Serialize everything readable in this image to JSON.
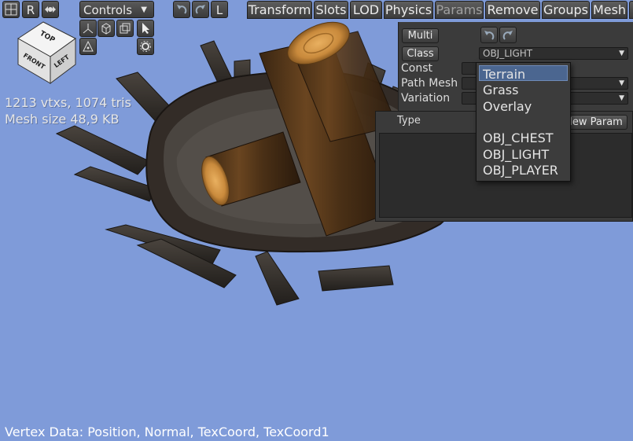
{
  "toolbar": {
    "r_label": "R",
    "controls_label": "Controls",
    "controls_arrow": "▼",
    "l_label": "L"
  },
  "tabs": [
    "Transform",
    "Slots",
    "LOD",
    "Physics",
    "Params",
    "Remove",
    "Groups",
    "Mesh"
  ],
  "disabled_tab": "Params",
  "params": {
    "multi_label": "Multi",
    "class_label": "Class",
    "class_value": "OBJ_LIGHT",
    "const_label": "Const",
    "path_mesh_label": "Path Mesh",
    "variation_label": "Variation",
    "type_header": "Type",
    "new_param_label": "New Param"
  },
  "dropdown": {
    "options": [
      "Terrain",
      "Grass",
      "Overlay",
      "",
      "OBJ_CHEST",
      "OBJ_LIGHT",
      "OBJ_PLAYER"
    ],
    "highlighted": "Terrain"
  },
  "view_cube": {
    "top": "TOP",
    "front": "FRONT",
    "left": "LEFT"
  },
  "stats": {
    "vertices_line": "1213 vtxs, 1074 tris",
    "mesh_size_line": "Mesh size 48,9 KB"
  },
  "footer": {
    "vertex_data": "Vertex Data: Position, Normal, TexCoord, TexCoord1"
  },
  "colors": {
    "viewport_bg": "#7f9bd9",
    "panel_bg": "#3b3b3b",
    "highlight": "#4b6690"
  }
}
